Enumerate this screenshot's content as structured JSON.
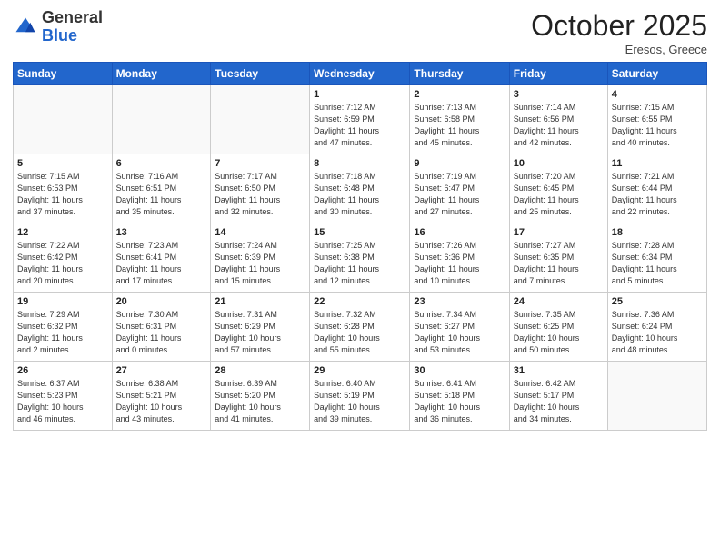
{
  "header": {
    "logo_general": "General",
    "logo_blue": "Blue",
    "month_title": "October 2025",
    "location": "Eresos, Greece"
  },
  "days_of_week": [
    "Sunday",
    "Monday",
    "Tuesday",
    "Wednesday",
    "Thursday",
    "Friday",
    "Saturday"
  ],
  "weeks": [
    [
      {
        "day": "",
        "info": ""
      },
      {
        "day": "",
        "info": ""
      },
      {
        "day": "",
        "info": ""
      },
      {
        "day": "1",
        "info": "Sunrise: 7:12 AM\nSunset: 6:59 PM\nDaylight: 11 hours\nand 47 minutes."
      },
      {
        "day": "2",
        "info": "Sunrise: 7:13 AM\nSunset: 6:58 PM\nDaylight: 11 hours\nand 45 minutes."
      },
      {
        "day": "3",
        "info": "Sunrise: 7:14 AM\nSunset: 6:56 PM\nDaylight: 11 hours\nand 42 minutes."
      },
      {
        "day": "4",
        "info": "Sunrise: 7:15 AM\nSunset: 6:55 PM\nDaylight: 11 hours\nand 40 minutes."
      }
    ],
    [
      {
        "day": "5",
        "info": "Sunrise: 7:15 AM\nSunset: 6:53 PM\nDaylight: 11 hours\nand 37 minutes."
      },
      {
        "day": "6",
        "info": "Sunrise: 7:16 AM\nSunset: 6:51 PM\nDaylight: 11 hours\nand 35 minutes."
      },
      {
        "day": "7",
        "info": "Sunrise: 7:17 AM\nSunset: 6:50 PM\nDaylight: 11 hours\nand 32 minutes."
      },
      {
        "day": "8",
        "info": "Sunrise: 7:18 AM\nSunset: 6:48 PM\nDaylight: 11 hours\nand 30 minutes."
      },
      {
        "day": "9",
        "info": "Sunrise: 7:19 AM\nSunset: 6:47 PM\nDaylight: 11 hours\nand 27 minutes."
      },
      {
        "day": "10",
        "info": "Sunrise: 7:20 AM\nSunset: 6:45 PM\nDaylight: 11 hours\nand 25 minutes."
      },
      {
        "day": "11",
        "info": "Sunrise: 7:21 AM\nSunset: 6:44 PM\nDaylight: 11 hours\nand 22 minutes."
      }
    ],
    [
      {
        "day": "12",
        "info": "Sunrise: 7:22 AM\nSunset: 6:42 PM\nDaylight: 11 hours\nand 20 minutes."
      },
      {
        "day": "13",
        "info": "Sunrise: 7:23 AM\nSunset: 6:41 PM\nDaylight: 11 hours\nand 17 minutes."
      },
      {
        "day": "14",
        "info": "Sunrise: 7:24 AM\nSunset: 6:39 PM\nDaylight: 11 hours\nand 15 minutes."
      },
      {
        "day": "15",
        "info": "Sunrise: 7:25 AM\nSunset: 6:38 PM\nDaylight: 11 hours\nand 12 minutes."
      },
      {
        "day": "16",
        "info": "Sunrise: 7:26 AM\nSunset: 6:36 PM\nDaylight: 11 hours\nand 10 minutes."
      },
      {
        "day": "17",
        "info": "Sunrise: 7:27 AM\nSunset: 6:35 PM\nDaylight: 11 hours\nand 7 minutes."
      },
      {
        "day": "18",
        "info": "Sunrise: 7:28 AM\nSunset: 6:34 PM\nDaylight: 11 hours\nand 5 minutes."
      }
    ],
    [
      {
        "day": "19",
        "info": "Sunrise: 7:29 AM\nSunset: 6:32 PM\nDaylight: 11 hours\nand 2 minutes."
      },
      {
        "day": "20",
        "info": "Sunrise: 7:30 AM\nSunset: 6:31 PM\nDaylight: 11 hours\nand 0 minutes."
      },
      {
        "day": "21",
        "info": "Sunrise: 7:31 AM\nSunset: 6:29 PM\nDaylight: 10 hours\nand 57 minutes."
      },
      {
        "day": "22",
        "info": "Sunrise: 7:32 AM\nSunset: 6:28 PM\nDaylight: 10 hours\nand 55 minutes."
      },
      {
        "day": "23",
        "info": "Sunrise: 7:34 AM\nSunset: 6:27 PM\nDaylight: 10 hours\nand 53 minutes."
      },
      {
        "day": "24",
        "info": "Sunrise: 7:35 AM\nSunset: 6:25 PM\nDaylight: 10 hours\nand 50 minutes."
      },
      {
        "day": "25",
        "info": "Sunrise: 7:36 AM\nSunset: 6:24 PM\nDaylight: 10 hours\nand 48 minutes."
      }
    ],
    [
      {
        "day": "26",
        "info": "Sunrise: 6:37 AM\nSunset: 5:23 PM\nDaylight: 10 hours\nand 46 minutes."
      },
      {
        "day": "27",
        "info": "Sunrise: 6:38 AM\nSunset: 5:21 PM\nDaylight: 10 hours\nand 43 minutes."
      },
      {
        "day": "28",
        "info": "Sunrise: 6:39 AM\nSunset: 5:20 PM\nDaylight: 10 hours\nand 41 minutes."
      },
      {
        "day": "29",
        "info": "Sunrise: 6:40 AM\nSunset: 5:19 PM\nDaylight: 10 hours\nand 39 minutes."
      },
      {
        "day": "30",
        "info": "Sunrise: 6:41 AM\nSunset: 5:18 PM\nDaylight: 10 hours\nand 36 minutes."
      },
      {
        "day": "31",
        "info": "Sunrise: 6:42 AM\nSunset: 5:17 PM\nDaylight: 10 hours\nand 34 minutes."
      },
      {
        "day": "",
        "info": ""
      }
    ]
  ]
}
